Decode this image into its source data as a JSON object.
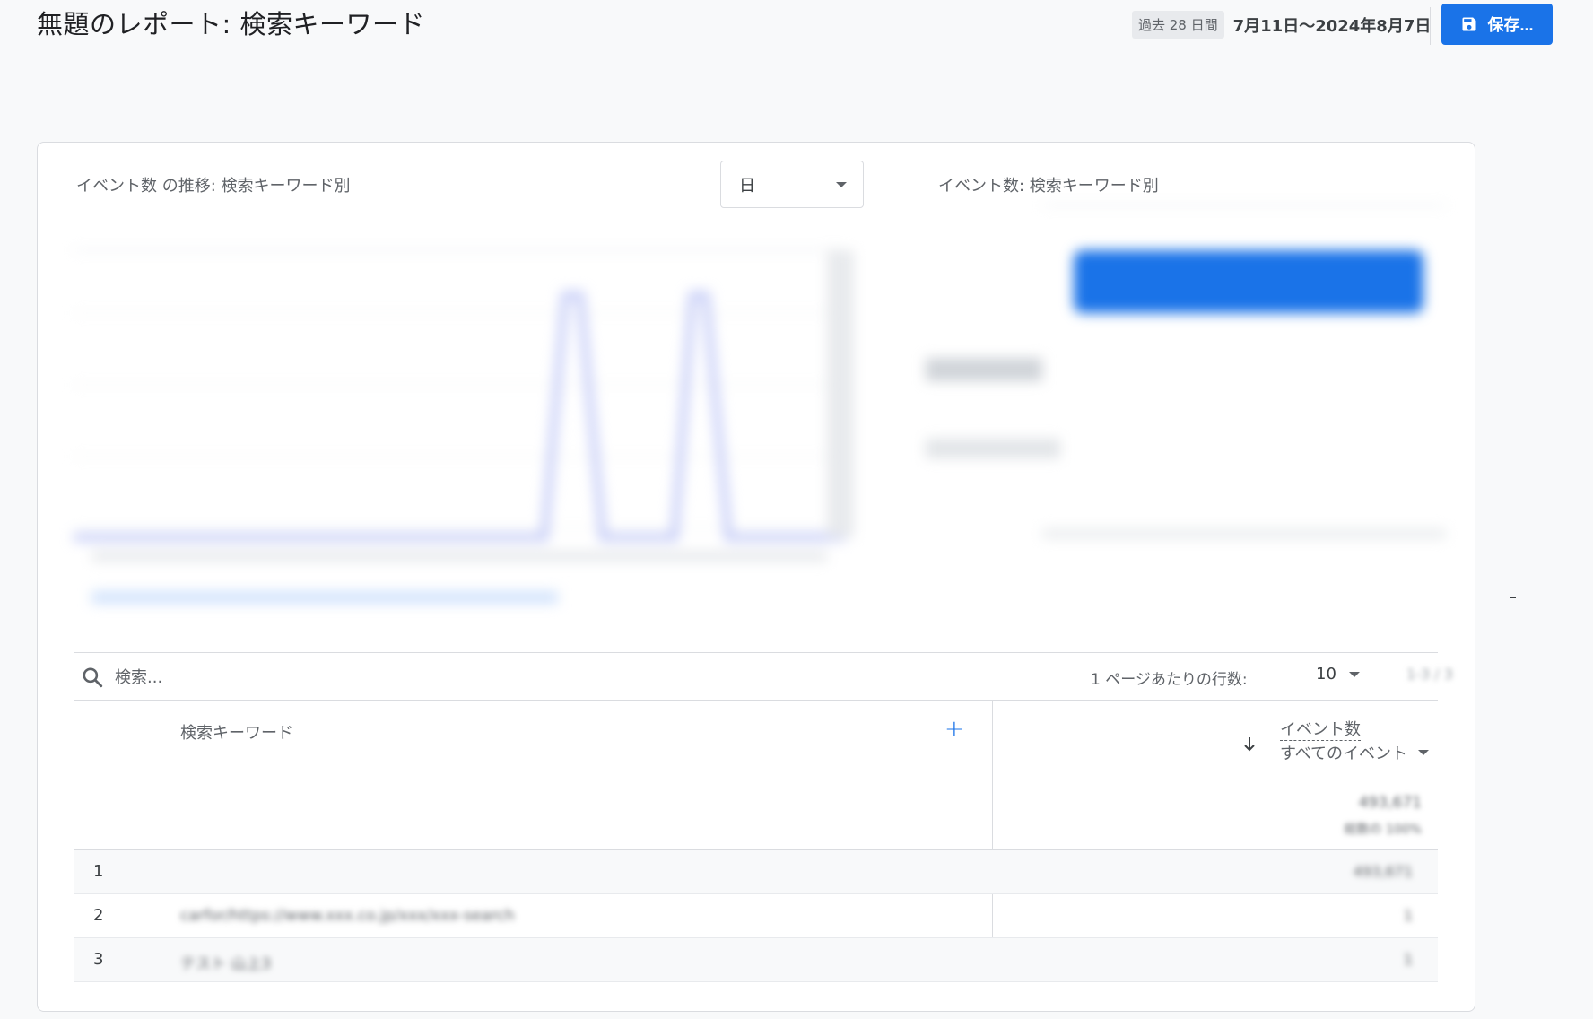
{
  "header": {
    "title": "無題のレポート: 検索キーワード",
    "date_chip": "過去 28 日間",
    "date_range": "7月11日～2024年8月7日",
    "save_label": "保存..."
  },
  "card": {
    "line_chart_title": "イベント数 の推移: 検索キーワード別",
    "granularity": "日",
    "bar_chart_title": "イベント数: 検索キーワード別"
  },
  "toolbar": {
    "search_placeholder": "検索...",
    "rows_per_page_label": "1 ページあたりの行数:",
    "rows_per_page_value": "10",
    "pagination": "1-3 / 3"
  },
  "table": {
    "dimension_header": "検索キーワード",
    "metric_header": "イベント数",
    "metric_filter": "すべてのイベント",
    "total_value": "493,671",
    "total_sub": "総数の 100%",
    "rows": [
      {
        "index": "1",
        "keyword": "",
        "value": "493,671"
      },
      {
        "index": "2",
        "keyword": "carfor/https://www.xxx.co.jp/xxx/xxx-search",
        "value": "1"
      },
      {
        "index": "3",
        "keyword": "テスト 山上3",
        "value": "1"
      }
    ]
  },
  "colors": {
    "accent": "#1a73e8",
    "bar_fill": "#1a73e8",
    "line_series": "#c6cdf7"
  }
}
